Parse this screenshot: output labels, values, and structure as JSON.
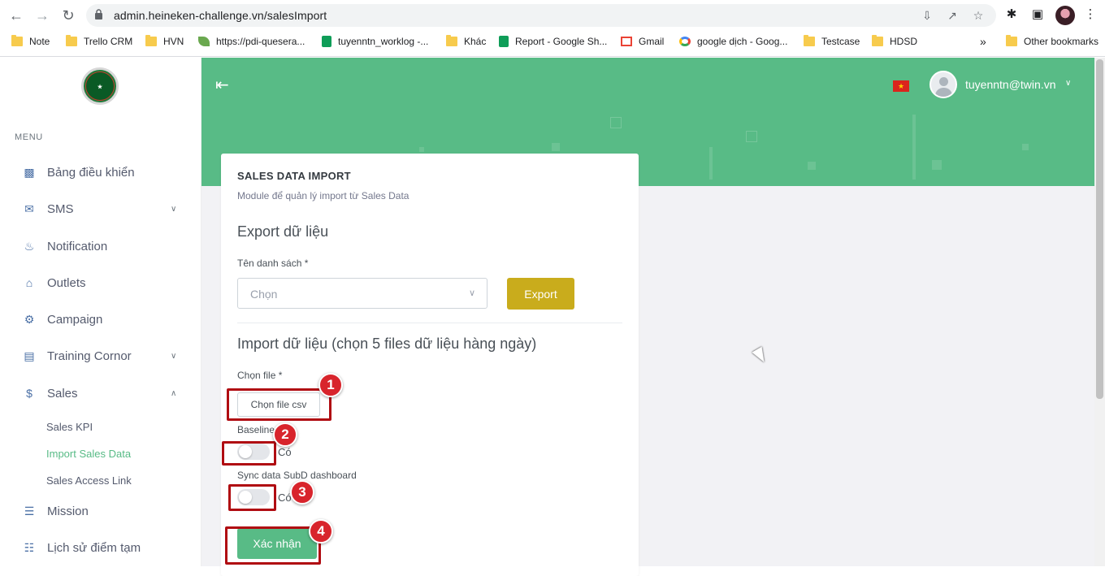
{
  "browser": {
    "url": "admin.heineken-challenge.vn/salesImport",
    "bookmarks": [
      {
        "label": "Note",
        "icon": "folder-icon"
      },
      {
        "label": "Trello CRM",
        "icon": "folder-icon"
      },
      {
        "label": "HVN",
        "icon": "folder-icon"
      },
      {
        "label": "https://pdi-quesera...",
        "icon": "leaf-icon"
      },
      {
        "label": "tuyenntn_worklog -...",
        "icon": "sheets-icon"
      },
      {
        "label": "Khác",
        "icon": "folder-icon"
      },
      {
        "label": "Report - Google Sh...",
        "icon": "sheets-icon"
      },
      {
        "label": "Gmail",
        "icon": "gmail-icon"
      },
      {
        "label": "google dịch - Goog...",
        "icon": "google-icon"
      },
      {
        "label": "Testcase",
        "icon": "folder-icon"
      },
      {
        "label": "HDSD",
        "icon": "folder-icon"
      }
    ],
    "overflow_label": "»",
    "other_bookmarks": "Other bookmarks"
  },
  "sidebar": {
    "menu_title": "MENU",
    "items": [
      {
        "label": "Bảng điều khiển",
        "icon": "dashboard-icon"
      },
      {
        "label": "SMS",
        "icon": "mail-icon",
        "expandable": true
      },
      {
        "label": "Notification",
        "icon": "bell-icon"
      },
      {
        "label": "Outlets",
        "icon": "store-icon"
      },
      {
        "label": "Campaign",
        "icon": "robot-icon"
      },
      {
        "label": "Training Cornor",
        "icon": "presentation-icon",
        "expandable": true
      },
      {
        "label": "Sales",
        "icon": "dollar-icon",
        "expandable": true,
        "expanded": true
      },
      {
        "label": "Mission",
        "icon": "clipboard-icon"
      },
      {
        "label": "Lịch sử điểm tạm",
        "icon": "document-icon"
      }
    ],
    "sales_sub": [
      {
        "label": "Sales KPI",
        "active": false
      },
      {
        "label": "Import Sales Data",
        "active": true
      },
      {
        "label": "Sales Access Link",
        "active": false
      }
    ]
  },
  "header": {
    "user": "tuyenntn@twin.vn",
    "language_flag": "vn-flag-icon"
  },
  "card": {
    "title": "SALES DATA IMPORT",
    "subtitle": "Module để quản lý import từ Sales Data",
    "export_section": "Export dữ liệu",
    "list_label": "Tên danh sách *",
    "list_placeholder": "Chọn",
    "export_button": "Export",
    "import_section": "Import dữ liệu (chọn 5 files dữ liệu hàng ngày)",
    "file_label": "Chọn file *",
    "file_button": "Chọn file csv",
    "baseline_label": "Baseline",
    "baseline_toggle_text": "Có",
    "sync_label": "Sync data SubD dashboard",
    "sync_toggle_text": "Có",
    "submit_button": "Xác nhận"
  },
  "annotations": [
    "1",
    "2",
    "3",
    "4"
  ],
  "colors": {
    "primary_green": "#58bb86",
    "export_gold": "#c9ac1c",
    "annotation_red": "#d8242c"
  }
}
